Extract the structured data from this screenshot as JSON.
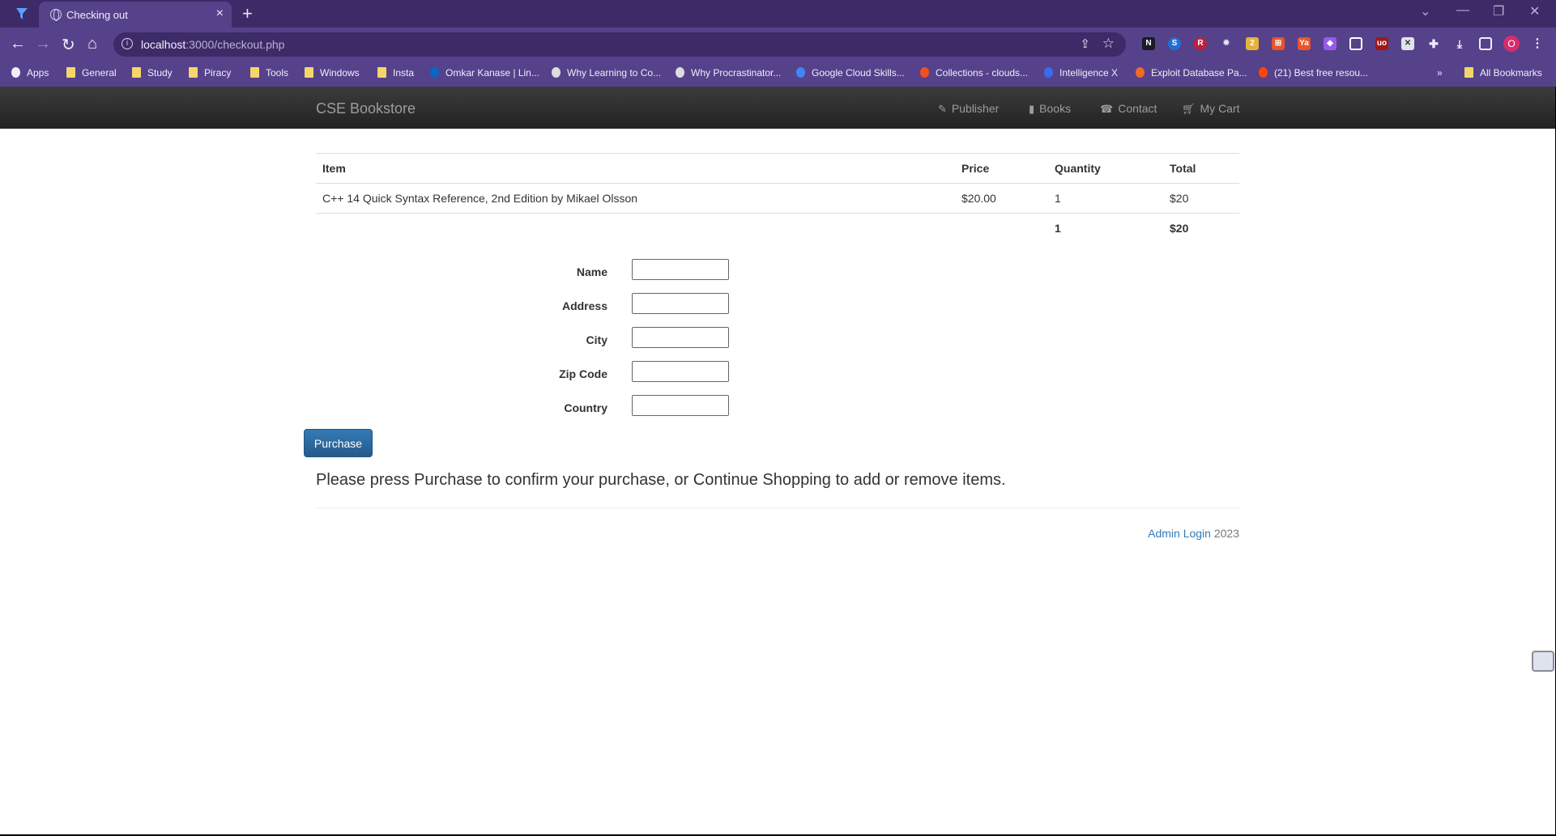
{
  "browser": {
    "tab_title": "Checking out",
    "tab_close": "×",
    "new_tab": "+",
    "url_host": "localhost",
    "url_rest": ":3000/checkout.php",
    "avatar_letter": "O",
    "bookmarks": [
      {
        "label": "Apps",
        "icon": "apps-grid-icon"
      },
      {
        "label": "General",
        "icon": "folder-icon"
      },
      {
        "label": "Study",
        "icon": "folder-icon"
      },
      {
        "label": "Piracy",
        "icon": "folder-icon"
      },
      {
        "label": "Tools",
        "icon": "folder-icon"
      },
      {
        "label": "Windows",
        "icon": "folder-icon"
      },
      {
        "label": "Insta",
        "icon": "folder-icon"
      },
      {
        "label": "Omkar Kanase | Lin...",
        "icon": "linkedin-icon"
      },
      {
        "label": "Why Learning to Co...",
        "icon": "site-icon"
      },
      {
        "label": "Why Procrastinator...",
        "icon": "site-icon"
      },
      {
        "label": "Google Cloud Skills...",
        "icon": "google-cloud-icon"
      },
      {
        "label": "Collections - clouds...",
        "icon": "microsoft-icon"
      },
      {
        "label": "Intelligence X",
        "icon": "intelx-icon"
      },
      {
        "label": "Exploit Database Pa...",
        "icon": "exploitdb-icon"
      },
      {
        "label": "(21) Best free resou...",
        "icon": "reddit-icon"
      }
    ],
    "bookmarks_overflow": "»",
    "all_bookmarks": "All Bookmarks"
  },
  "site": {
    "brand": "CSE Bookstore",
    "nav": [
      {
        "label": "Publisher",
        "icon": "paperclip-icon"
      },
      {
        "label": "Books",
        "icon": "book-icon"
      },
      {
        "label": "Contact",
        "icon": "phone-icon"
      },
      {
        "label": "My Cart",
        "icon": "cart-icon"
      }
    ]
  },
  "cart": {
    "headers": [
      "Item",
      "Price",
      "Quantity",
      "Total"
    ],
    "rows": [
      {
        "item": "C++ 14 Quick Syntax Reference, 2nd Edition by Mikael Olsson",
        "price": "$20.00",
        "quantity": "1",
        "total": "$20"
      }
    ],
    "summary": {
      "quantity": "1",
      "total": "$20"
    }
  },
  "form": {
    "fields": [
      {
        "label": "Name",
        "value": ""
      },
      {
        "label": "Address",
        "value": ""
      },
      {
        "label": "City",
        "value": ""
      },
      {
        "label": "Zip Code",
        "value": ""
      },
      {
        "label": "Country",
        "value": ""
      }
    ],
    "submit_label": "Purchase"
  },
  "notice": "Please press Purchase to confirm your purchase, or Continue Shopping to add or remove items.",
  "footer": {
    "link": "Admin Login",
    "year": "2023"
  },
  "colors": {
    "chrome": "#55428a",
    "tabbar": "#3d2b68",
    "primary": "#337ab7"
  }
}
